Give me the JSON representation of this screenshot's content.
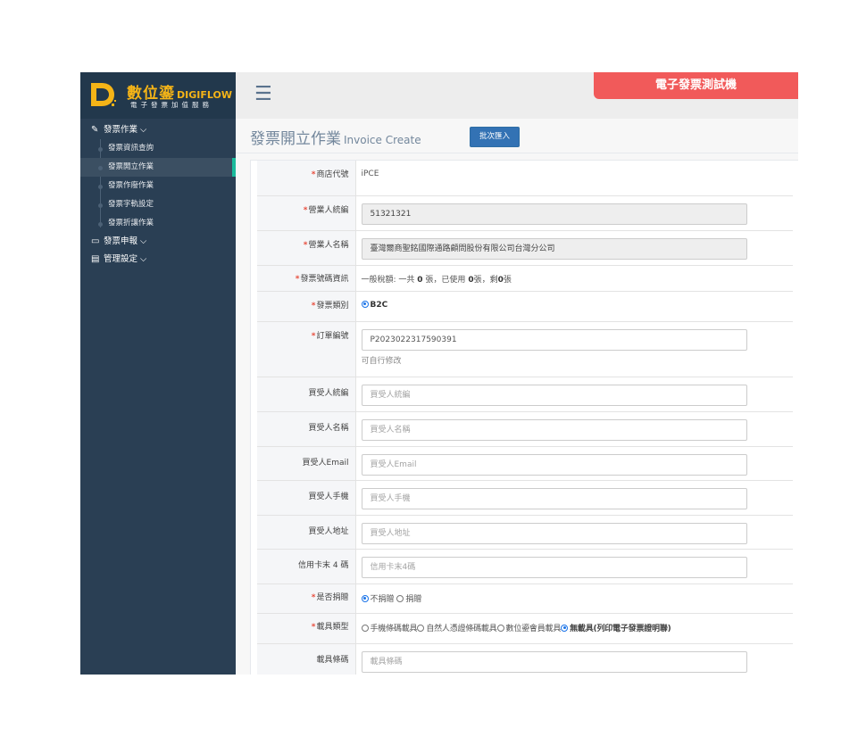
{
  "brand": {
    "name_zh": "數位鎏",
    "name_en": "DIGIFLOW",
    "tagline": "電子發票加值服務"
  },
  "sidebar": {
    "groups": [
      {
        "label": "發票作業",
        "icon": "edit-icon",
        "expanded": true,
        "items": [
          {
            "label": "發票資訊查詢",
            "active": false
          },
          {
            "label": "發票開立作業",
            "active": true
          },
          {
            "label": "發票作廢作業",
            "active": false
          },
          {
            "label": "發票字軌設定",
            "active": false
          },
          {
            "label": "發票折讓作業",
            "active": false
          }
        ]
      },
      {
        "label": "發票申報",
        "icon": "monitor-icon",
        "expanded": false
      },
      {
        "label": "管理設定",
        "icon": "computer-icon",
        "expanded": false
      }
    ]
  },
  "topbar": {
    "banner": "電子發票測試機"
  },
  "page": {
    "title_zh": "發票開立作業",
    "title_en": "Invoice Create",
    "batch_import_label": "批次匯入"
  },
  "form": {
    "store_code": {
      "label": "商店代號",
      "value": "iPCE"
    },
    "seller_id": {
      "label": "營業人統編",
      "value": "51321321"
    },
    "seller_name": {
      "label": "營業人名稱",
      "value": "臺灣爾商聖銘國際通路顧問股份有限公司台灣分公司"
    },
    "track_info": {
      "label": "發票號碼資訊",
      "prefix": "一般稅額: 一共",
      "total": "0",
      "mid1": "張，已使用",
      "used": "0",
      "mid2": "張，剩",
      "remaining": "0",
      "suffix": "張"
    },
    "invoice_type": {
      "label": "發票類別",
      "option": "B2C"
    },
    "order_no": {
      "label": "訂單編號",
      "value": "P2023022317590391",
      "hint": "可自行修改"
    },
    "buyer_id": {
      "label": "買受人統編",
      "placeholder": "買受人統編"
    },
    "buyer_name": {
      "label": "買受人名稱",
      "placeholder": "買受人名稱"
    },
    "buyer_email": {
      "label": "買受人Email",
      "placeholder": "買受人Email"
    },
    "buyer_phone": {
      "label": "買受人手機",
      "placeholder": "買受人手機"
    },
    "buyer_address": {
      "label": "買受人地址",
      "placeholder": "買受人地址"
    },
    "card_last4": {
      "label": "信用卡末 4 碼",
      "placeholder": "信用卡末4碼"
    },
    "donate": {
      "label": "是否捐贈",
      "opt_no": "不捐贈",
      "opt_yes": "捐贈",
      "selected": "不捐贈"
    },
    "carrier_type": {
      "label": "載具類型",
      "options": [
        "手機條碼載具",
        "自然人憑證條碼載具",
        "數位鎏會員載具",
        "無載具(列印電子發票證明聯)"
      ],
      "selected": "無載具(列印電子發票證明聯)"
    },
    "carrier_code": {
      "label": "載具條碼",
      "placeholder": "載具條碼"
    }
  },
  "colors": {
    "sidebar_bg": "#2a3f54",
    "banner_bg": "#f15a5a",
    "brand_gold": "#f5b417",
    "button_blue": "#3372b4",
    "active_accent": "#1abb9c"
  }
}
